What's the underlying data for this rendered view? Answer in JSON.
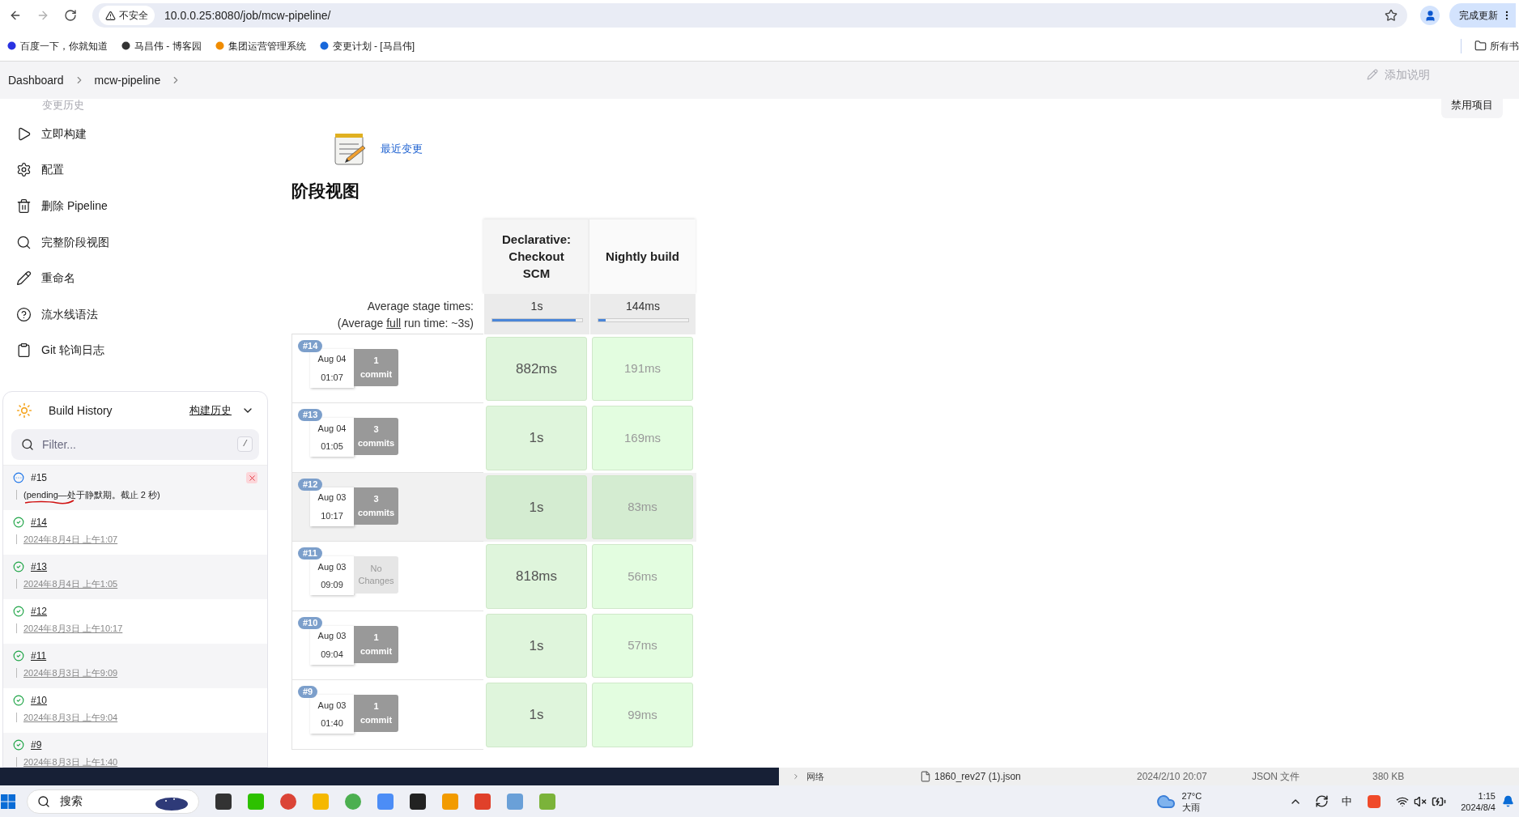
{
  "browser": {
    "nav": [
      {
        "kind": "back",
        "disabled": false
      },
      {
        "kind": "forward",
        "disabled": true
      },
      {
        "kind": "reload",
        "disabled": false
      }
    ],
    "security": "不安全",
    "url": "10.0.0.25:8080/job/mcw-pipeline/",
    "update_button": "完成更新"
  },
  "bookmarks": [
    {
      "label": "百度一下，你就知道"
    },
    {
      "label": "马昌伟 - 博客园"
    },
    {
      "label": "集团运营管理系统"
    },
    {
      "label": "变更计划 - [马昌伟]"
    }
  ],
  "all_bookmarks": "所有书",
  "breadcrumb": [
    "Dashboard",
    "mcw-pipeline"
  ],
  "faded": {
    "sidebar_top": "变更历史",
    "add_description": "添加说明"
  },
  "disable_button": "禁用项目",
  "sidebar": {
    "items": [
      {
        "label": "立即构建"
      },
      {
        "label": "配置"
      },
      {
        "label": "删除 Pipeline"
      },
      {
        "label": "完整阶段视图"
      },
      {
        "label": "重命名"
      },
      {
        "label": "流水线语法"
      },
      {
        "label": "Git 轮询日志"
      }
    ]
  },
  "build_history": {
    "title": "Build History",
    "link": "构建历史",
    "filter_placeholder": "Filter...",
    "filter_key": "/",
    "builds": [
      {
        "kind": "pending",
        "number": "#15",
        "text": "(pending—处于静默期。截止 2 秒)"
      },
      {
        "kind": "success",
        "number": "#14",
        "date": "2024年8月4日 上午1:07"
      },
      {
        "kind": "success",
        "number": "#13",
        "date": "2024年8月4日 上午1:05"
      },
      {
        "kind": "success",
        "number": "#12",
        "date": "2024年8月3日 上午10:17"
      },
      {
        "kind": "success",
        "number": "#11",
        "date": "2024年8月3日 上午9:09"
      },
      {
        "kind": "success",
        "number": "#10",
        "date": "2024年8月3日 上午9:04"
      },
      {
        "kind": "success",
        "number": "#9",
        "date": "2024年8月3日 上午1:40"
      }
    ]
  },
  "recent_changes": "最近变更",
  "stage_view": {
    "title": "阶段视图",
    "stages": [
      "Declarative: Checkout SCM",
      "Nightly build"
    ],
    "average_label": "Average stage times:",
    "average_prefix": "(Average ",
    "average_link": "full",
    "average_suffix": " run time: ~3s)",
    "averages": [
      {
        "text": "1s",
        "level": 0.93
      },
      {
        "text": "144ms",
        "level": 0.09
      }
    ],
    "runs": [
      {
        "number": "#14",
        "date": "Aug 04",
        "time": "01:07",
        "changes": {
          "kind": "commits",
          "count": "1",
          "label": "commit"
        },
        "highlighted": false,
        "durations": [
          "882ms",
          "191ms"
        ]
      },
      {
        "number": "#13",
        "date": "Aug 04",
        "time": "01:05",
        "changes": {
          "kind": "commits",
          "count": "3",
          "label": "commits"
        },
        "highlighted": false,
        "durations": [
          "1s",
          "169ms"
        ]
      },
      {
        "number": "#12",
        "date": "Aug 03",
        "time": "10:17",
        "changes": {
          "kind": "commits",
          "count": "3",
          "label": "commits"
        },
        "highlighted": true,
        "durations": [
          "1s",
          "83ms"
        ]
      },
      {
        "number": "#11",
        "date": "Aug 03",
        "time": "09:09",
        "changes": {
          "kind": "none",
          "label": "No Changes"
        },
        "highlighted": false,
        "durations": [
          "818ms",
          "56ms"
        ]
      },
      {
        "number": "#10",
        "date": "Aug 03",
        "time": "09:04",
        "changes": {
          "kind": "commits",
          "count": "1",
          "label": "commit"
        },
        "highlighted": false,
        "durations": [
          "1s",
          "57ms"
        ]
      },
      {
        "number": "#9",
        "date": "Aug 03",
        "time": "01:40",
        "changes": {
          "kind": "commits",
          "count": "1",
          "label": "commit"
        },
        "highlighted": false,
        "durations": [
          "1s",
          "99ms"
        ]
      }
    ]
  },
  "explorer_row": {
    "folder": "网络",
    "file": "1860_rev27 (1).json",
    "modified": "2024/2/10 20:07",
    "type": "JSON 文件",
    "size": "380 KB"
  },
  "taskbar": {
    "search": "搜索",
    "temperature": "27°C",
    "condition": "大雨",
    "ime": "中",
    "time": "1:15",
    "date": "2024/8/4"
  }
}
